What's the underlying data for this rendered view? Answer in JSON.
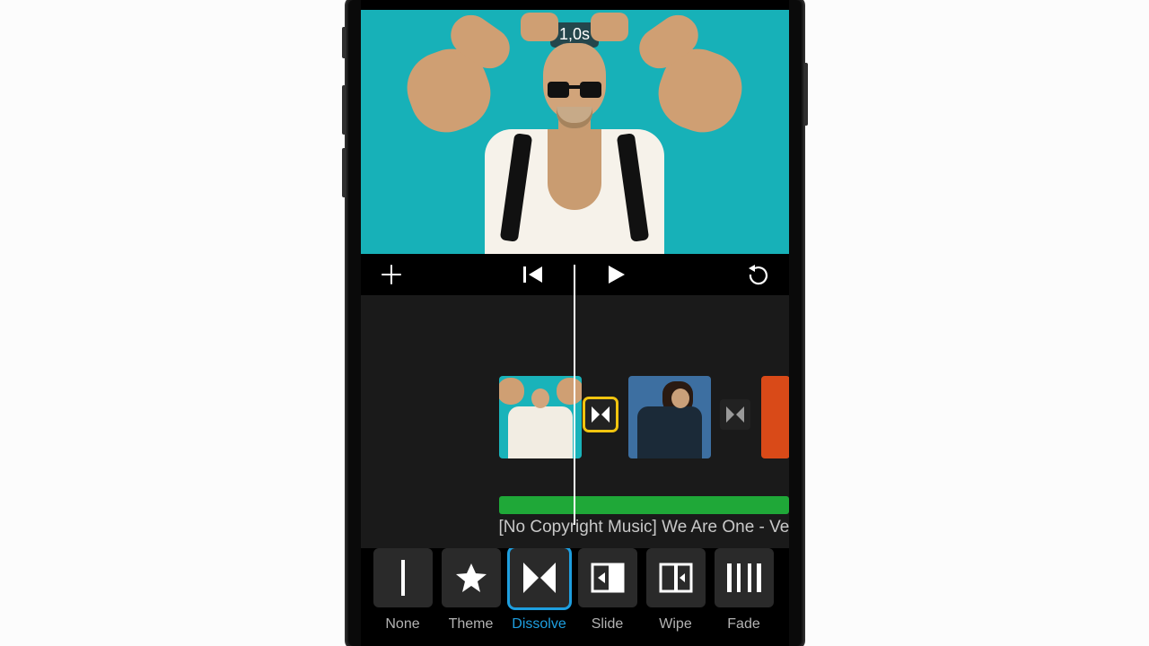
{
  "preview": {
    "duration_chip": "1,0s"
  },
  "timeline": {
    "audio_label": "[No Copyright Music] We Are One - Ve"
  },
  "transitions": {
    "options": [
      {
        "label": "None"
      },
      {
        "label": "Theme"
      },
      {
        "label": "Dissolve"
      },
      {
        "label": "Slide"
      },
      {
        "label": "Wipe"
      },
      {
        "label": "Fade"
      }
    ],
    "selected_index": 2
  }
}
